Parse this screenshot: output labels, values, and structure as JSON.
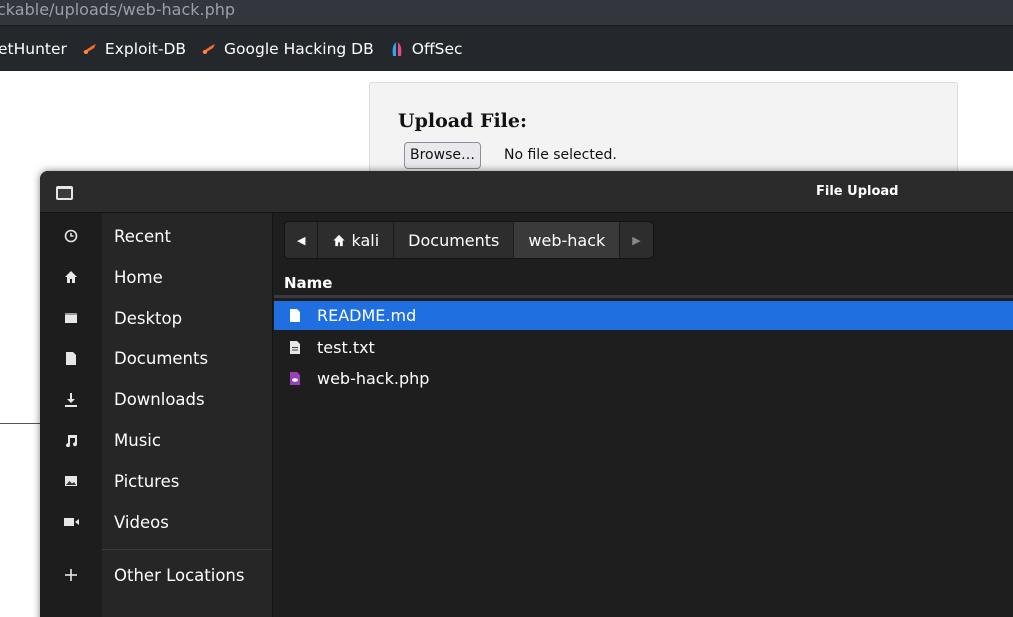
{
  "browser": {
    "url_text": "ckable/uploads/web-hack.php",
    "bookmarks": [
      {
        "label": "etHunter",
        "icon": "none"
      },
      {
        "label": "Exploit-DB",
        "icon": "exploitdb-icon"
      },
      {
        "label": "Google Hacking DB",
        "icon": "exploitdb-icon"
      },
      {
        "label": "OffSec",
        "icon": "offsec-icon"
      }
    ]
  },
  "page": {
    "upload_title": "Upload File:",
    "browse_label": "Browse…",
    "no_file_text": "No file selected."
  },
  "dialog": {
    "title": "File Upload",
    "sidebar": [
      {
        "label": "Recent",
        "icon": "clock-icon"
      },
      {
        "label": "Home",
        "icon": "home-icon"
      },
      {
        "label": "Desktop",
        "icon": "desktop-icon"
      },
      {
        "label": "Documents",
        "icon": "document-icon"
      },
      {
        "label": "Downloads",
        "icon": "download-icon"
      },
      {
        "label": "Music",
        "icon": "music-icon"
      },
      {
        "label": "Pictures",
        "icon": "picture-icon"
      },
      {
        "label": "Videos",
        "icon": "video-icon"
      },
      {
        "label": "Other Locations",
        "icon": "plus-icon"
      }
    ],
    "path": [
      "kali",
      "Documents",
      "web-hack"
    ],
    "column_name": "Name",
    "files": [
      {
        "name": "README.md",
        "icon": "file-icon",
        "selected": true
      },
      {
        "name": "test.txt",
        "icon": "text-file-icon",
        "selected": false
      },
      {
        "name": "web-hack.php",
        "icon": "php-file-icon",
        "selected": false
      }
    ]
  },
  "colors": {
    "selection": "#1f6fe0",
    "dialog_bg": "#1e1e1e",
    "sidebar_bg": "#262626"
  }
}
